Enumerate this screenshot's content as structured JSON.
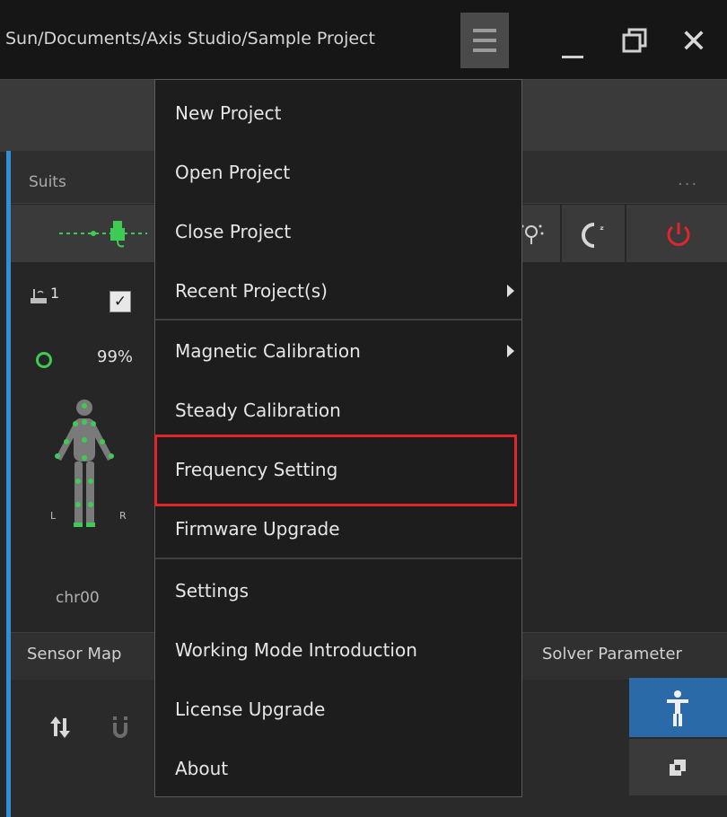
{
  "window": {
    "path": "Sun/Documents/Axis Studio/Sample Project",
    "close_glyph": "✕"
  },
  "suits_panel": {
    "title": "Suits",
    "more": "...",
    "receiver_index": "1",
    "checkbox_checked": true,
    "check_glyph": "✓",
    "battery": "99%",
    "left_label": "L",
    "right_label": "R",
    "character_name": "chr00",
    "toolbar_icons": [
      "usb-icon",
      "lightbulb-icon",
      "sleep-icon",
      "power-icon"
    ],
    "sleep_glyph": "ᶻ"
  },
  "tabs": {
    "sensor": "Sensor Map",
    "solver": "Solver Parameter"
  },
  "colors": {
    "accent_blue": "#2f8fd8",
    "power_red": "#e0262a",
    "status_green": "#3ecb53",
    "highlight_red": "#e0262a"
  },
  "menu": {
    "items": [
      {
        "label": "New Project",
        "submenu": false
      },
      {
        "label": "Open Project",
        "submenu": false
      },
      {
        "label": "Close Project",
        "submenu": false
      },
      {
        "label": "Recent Project(s)",
        "submenu": true
      },
      {
        "label": "Magnetic Calibration",
        "submenu": true
      },
      {
        "label": "Steady Calibration",
        "submenu": false
      },
      {
        "label": "Frequency Setting",
        "submenu": false,
        "highlighted": true
      },
      {
        "label": "Firmware Upgrade",
        "submenu": false
      },
      {
        "label": "Settings",
        "submenu": false
      },
      {
        "label": "Working Mode Introduction",
        "submenu": false
      },
      {
        "label": "License Upgrade",
        "submenu": false
      },
      {
        "label": "About",
        "submenu": false
      }
    ]
  }
}
